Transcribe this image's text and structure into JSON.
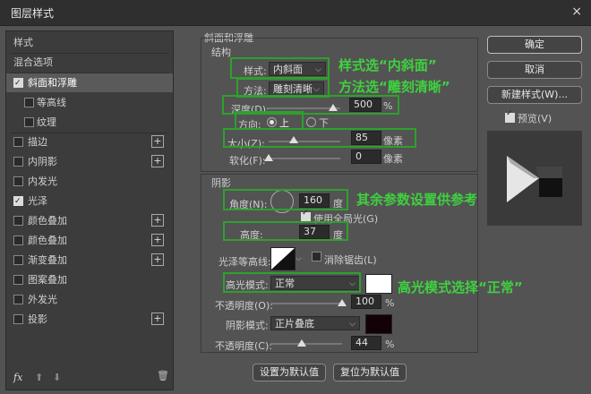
{
  "window": {
    "title": "图层样式",
    "close_icon": "×"
  },
  "sidebar": {
    "items": [
      {
        "label": "样式",
        "checkbox": false,
        "plus": false
      },
      {
        "label": "混合选项",
        "checkbox": false,
        "plus": false
      },
      {
        "label": "斜面和浮雕",
        "checkbox": true,
        "checked": true,
        "plus": false,
        "active": true
      },
      {
        "label": "等高线",
        "checkbox": true,
        "checked": false,
        "plus": false,
        "indent": true
      },
      {
        "label": "纹理",
        "checkbox": true,
        "checked": false,
        "plus": false,
        "indent": true
      },
      {
        "label": "描边",
        "checkbox": true,
        "checked": false,
        "plus": true
      },
      {
        "label": "内阴影",
        "checkbox": true,
        "checked": false,
        "plus": true
      },
      {
        "label": "内发光",
        "checkbox": true,
        "checked": false,
        "plus": false
      },
      {
        "label": "光泽",
        "checkbox": true,
        "checked": true,
        "plus": false
      },
      {
        "label": "颜色叠加",
        "checkbox": true,
        "checked": false,
        "plus": true
      },
      {
        "label": "颜色叠加",
        "checkbox": true,
        "checked": false,
        "plus": true
      },
      {
        "label": "渐变叠加",
        "checkbox": true,
        "checked": false,
        "plus": true
      },
      {
        "label": "图案叠加",
        "checkbox": true,
        "checked": false,
        "plus": false
      },
      {
        "label": "外发光",
        "checkbox": true,
        "checked": false,
        "plus": false
      },
      {
        "label": "投影",
        "checkbox": true,
        "checked": false,
        "plus": true
      }
    ],
    "fx_label": "fx",
    "plus_icon": "+",
    "up_icon": "⬆",
    "down_icon": "⬇",
    "trash_icon": "🗑"
  },
  "bevel": {
    "section_title": "斜面和浮雕",
    "structure_title": "结构",
    "style_label": "样式:",
    "style_value": "内斜面",
    "technique_label": "方法:",
    "technique_value": "雕刻清晰",
    "depth_label": "深度(D):",
    "depth_value": "500",
    "depth_unit": "%",
    "depth_level": 0.9,
    "direction_label": "方向:",
    "direction_up": "上",
    "direction_down": "下",
    "size_label": "大小(Z):",
    "size_value": "85",
    "size_unit": "像素",
    "size_level": 0.35,
    "soften_label": "软化(F):",
    "soften_value": "0",
    "soften_unit": "像素",
    "soften_level": 0.0,
    "shading_title": "阴影",
    "angle_label": "角度(N):",
    "angle_value": "160",
    "angle_unit": "度",
    "global_light_label": "使用全局光(G)",
    "altitude_label": "高度:",
    "altitude_value": "37",
    "altitude_unit": "度",
    "gloss_contour_label": "光泽等高线:",
    "antialias_label": "消除锯齿(L)",
    "highlight_mode_label": "高光模式:",
    "highlight_mode_value": "正常",
    "opacity_label_1": "不透明度(O):",
    "opacity_value_1": "100",
    "opacity_unit": "%",
    "opacity_level_1": 1.0,
    "shadow_mode_label": "阴影模式:",
    "shadow_mode_value": "正片叠底",
    "opacity_label_2": "不透明度(C):",
    "opacity_value_2": "44",
    "opacity_level_2": 0.44,
    "highlight_color": "#ffffff",
    "shadow_color": "#120208",
    "set_default_button": "设置为默认值",
    "reset_default_button": "复位为默认值"
  },
  "right_panel": {
    "ok_button": "确定",
    "cancel_button": "取消",
    "new_style_button": "新建样式(W)...",
    "preview_label": "预览(V)"
  },
  "annotations": {
    "a1": "样式选“内斜面”",
    "a2": "方法选“雕刻清晰”",
    "a3": "其余参数设置供参考",
    "a4": "高光模式选择“正常”"
  },
  "colors": {
    "annotation_green": "#3fd13f",
    "box_green": "#2ea02e"
  }
}
